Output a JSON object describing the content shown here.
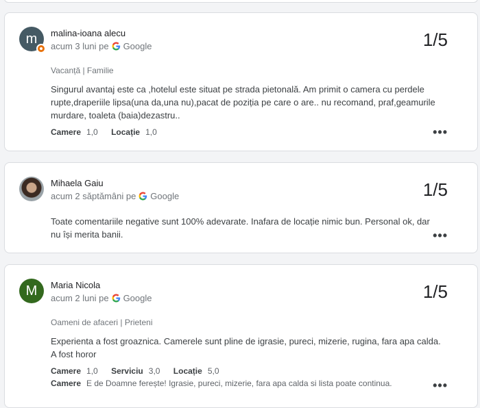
{
  "reviews": [
    {
      "author": "malina-ioana alecu",
      "avatar_letter": "m",
      "avatar_color": "#455a64",
      "time": "acum 3 luni pe",
      "source": "Google",
      "rating": "1/5",
      "tags": "Vacanță | Familie",
      "text": "Singurul avantaj este ca ,hotelul este situat pe strada pietonală. Am primit o camera cu perdele rupte,draperiile lipsa(una da,una nu),pacat de poziția pe care o are.. nu recomand, praf,geamurile murdare, toaleta (baia)dezastru..",
      "aspects": [
        {
          "label": "Camere",
          "value": "1,0"
        },
        {
          "label": "Locație",
          "value": "1,0"
        }
      ],
      "more_icon": "more-horiz-icon"
    },
    {
      "author": "Mihaela Gaiu",
      "time": "acum 2 săptămâni pe",
      "source": "Google",
      "rating": "1/5",
      "text": "Toate comentariile negative sunt 100% adevarate. Inafara de locație nimic bun. Personal ok, dar nu își merita banii.",
      "more_icon": "more-horiz-icon"
    },
    {
      "author": "Maria Nicola",
      "avatar_letter": "M",
      "avatar_color": "#33691e",
      "time": "acum 2 luni pe",
      "source": "Google",
      "rating": "1/5",
      "tags": "Oameni de afaceri | Prieteni",
      "text": "Experienta a fost groaznica. Camerele sunt pline de igrasie, pureci, mizerie, rugina, fara apa calda. A fost horor",
      "aspects": [
        {
          "label": "Camere",
          "value": "1,0"
        },
        {
          "label": "Serviciu",
          "value": "3,0"
        },
        {
          "label": "Locație",
          "value": "5,0"
        }
      ],
      "note_label": "Camere",
      "note_text": "E de Doamne ferește! Igrasie, pureci, mizerie, fara apa calda si lista poate continua.",
      "more_icon": "more-horiz-icon"
    }
  ]
}
